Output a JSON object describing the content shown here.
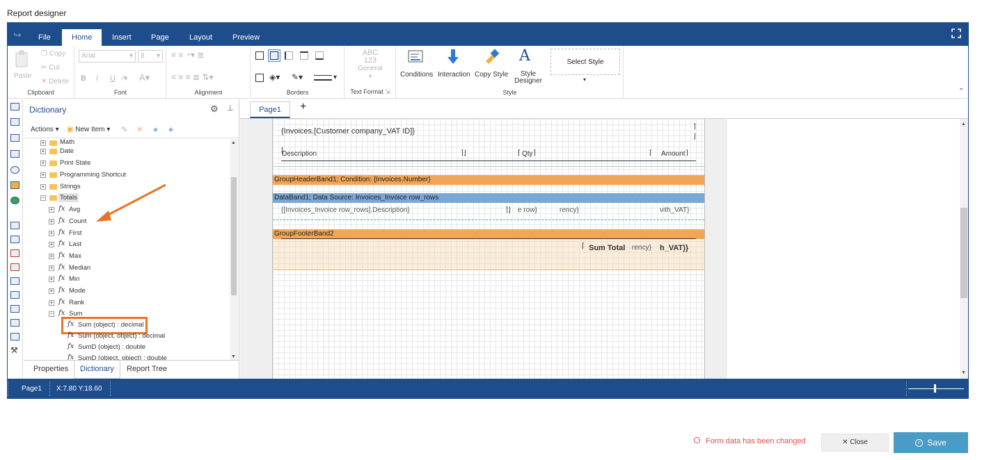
{
  "window": {
    "title": "Report designer"
  },
  "menu": {
    "tabs": [
      "File",
      "Home",
      "Insert",
      "Page",
      "Layout",
      "Preview"
    ],
    "active": "Home"
  },
  "ribbon": {
    "clipboard": {
      "label": "Clipboard",
      "paste": "Paste",
      "copy": "Copy",
      "cut": "Cut",
      "delete": "Delete"
    },
    "font": {
      "label": "Font",
      "family": "Arial",
      "size": "8",
      "bold": "B",
      "italic": "I",
      "underline": "U"
    },
    "alignment": {
      "label": "Alignment"
    },
    "borders": {
      "label": "Borders"
    },
    "text_format": {
      "label": "Text Format",
      "preview_top": "ABC",
      "preview_mid": "123",
      "preview_bottom": "General"
    },
    "style": {
      "label": "Style",
      "conditions": "Conditions",
      "interaction": "Interaction",
      "copy_style": "Copy Style",
      "style_designer": "Style Designer",
      "select_style": "Select Style"
    }
  },
  "dictionary": {
    "title": "Dictionary",
    "actions": "Actions",
    "new_item": "New Item",
    "folders": [
      {
        "label": "Math",
        "expander": "+"
      },
      {
        "label": "Date",
        "expander": "+"
      },
      {
        "label": "Print State",
        "expander": "+"
      },
      {
        "label": "Programming Shortcut",
        "expander": "+"
      },
      {
        "label": "Strings",
        "expander": "+"
      },
      {
        "label": "Totals",
        "expander": "−"
      }
    ],
    "functions": [
      {
        "label": "Avg",
        "expander": "+"
      },
      {
        "label": "Count",
        "expander": "+"
      },
      {
        "label": "First",
        "expander": "+"
      },
      {
        "label": "Last",
        "expander": "+"
      },
      {
        "label": "Max",
        "expander": "+"
      },
      {
        "label": "Median",
        "expander": "+"
      },
      {
        "label": "Min",
        "expander": "+"
      },
      {
        "label": "Mode",
        "expander": "+"
      },
      {
        "label": "Rank",
        "expander": "+"
      },
      {
        "label": "Sum",
        "expander": "−"
      }
    ],
    "overloads": [
      "Sum (object) : decimal",
      "Sum (object, object) : decimal",
      "SumD (object) : double",
      "SumD (object, object) : double"
    ],
    "fx_symbol": "fx",
    "tabs": [
      "Properties",
      "Dictionary",
      "Report Tree"
    ],
    "active_tab": "Dictionary"
  },
  "pages": {
    "tab": "Page1",
    "add": "+"
  },
  "report": {
    "vat_field": "{Invoices.[Customer company_VAT ID]}",
    "header_desc": "Description",
    "header_qty": "Qty",
    "header_amount": "Amount",
    "group_header": "GroupHeaderBand1; Condition: {Invoices.Number}",
    "data_band": "DataBand1; Data Source: Invoices_Invoice row_rows",
    "data_desc": "{[Invoices_Invoice row_rows].Description}",
    "data_row": "e row}",
    "data_currency": "rency}",
    "data_vat": "vith_VAT}",
    "group_footer": "GroupFooterBand2",
    "sum_total": "Sum Total",
    "footer_currency": "rency}",
    "footer_vat": "h_VAT)}"
  },
  "statusbar": {
    "page": "Page1",
    "coords": "X:7.80 Y:18.60"
  },
  "footer": {
    "changed": "Form data has been changed",
    "close": "Close",
    "save": "Save"
  },
  "colors": {
    "brand": "#1e4d8c",
    "orange_band": "#f0a656",
    "blue_band": "#7ba7d7",
    "save": "#4a9bc5",
    "highlight": "#e8742a"
  }
}
